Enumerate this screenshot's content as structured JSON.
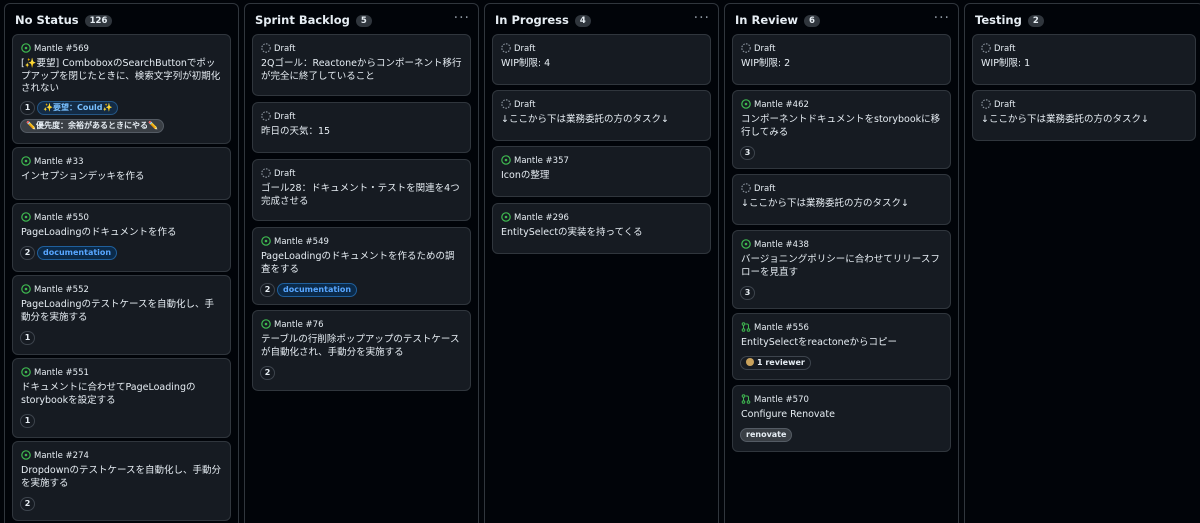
{
  "columns": [
    {
      "title": "No Status",
      "count": "126",
      "cards": [
        {
          "type": "issue",
          "meta": "Mantle #569",
          "title": "[✨要望] ComboboxのSearchButtonでポップアップを閉じたときに、検索文字列が初期化されない",
          "count": "1",
          "labels": [
            "✨要望：Could✨",
            "✏️優先度：余裕があるときにやる✏️"
          ]
        },
        {
          "type": "issue",
          "meta": "Mantle #33",
          "title": "インセプションデッキを作る"
        },
        {
          "type": "issue",
          "meta": "Mantle #550",
          "title": "PageLoadingのドキュメントを作る",
          "count": "2",
          "labels": [
            "documentation"
          ]
        },
        {
          "type": "issue",
          "meta": "Mantle #552",
          "title": "PageLoadingのテストケースを自動化し、手動分を実施する",
          "count": "1"
        },
        {
          "type": "issue",
          "meta": "Mantle #551",
          "title": "ドキュメントに合わせてPageLoadingのstorybookを設定する",
          "count": "1"
        },
        {
          "type": "issue",
          "meta": "Mantle #274",
          "title": "Dropdownのテストケースを自動化し、手動分を実施する",
          "count": "2"
        }
      ]
    },
    {
      "title": "Sprint Backlog",
      "count": "5",
      "cards": [
        {
          "type": "draft",
          "meta": "Draft",
          "title": "2Qゴール：Reactoneからコンポーネント移行が完全に終了していること"
        },
        {
          "type": "draft",
          "meta": "Draft",
          "title": "昨日の天気：15"
        },
        {
          "type": "draft",
          "meta": "Draft",
          "title": "ゴール28：ドキュメント・テストを関連を4つ完成させる"
        },
        {
          "type": "issue",
          "meta": "Mantle #549",
          "title": "PageLoadingのドキュメントを作るための調査をする",
          "count": "2",
          "labels": [
            "documentation"
          ]
        },
        {
          "type": "issue",
          "meta": "Mantle #76",
          "title": "テーブルの行削除ポップアップのテストケースが自動化され、手動分を実施する",
          "count": "2"
        }
      ]
    },
    {
      "title": "In Progress",
      "count": "4",
      "cards": [
        {
          "type": "draft",
          "meta": "Draft",
          "title": "WIP制限: 4"
        },
        {
          "type": "draft",
          "meta": "Draft",
          "title": "↓ここから下は業務委託の方のタスク↓"
        },
        {
          "type": "issue",
          "meta": "Mantle #357",
          "title": "Iconの整理"
        },
        {
          "type": "issue",
          "meta": "Mantle #296",
          "title": "EntitySelectの実装を持ってくる"
        }
      ]
    },
    {
      "title": "In Review",
      "count": "6",
      "cards": [
        {
          "type": "draft",
          "meta": "Draft",
          "title": "WIP制限: 2"
        },
        {
          "type": "issue",
          "meta": "Mantle #462",
          "title": "コンポーネントドキュメントをstorybookに移行してみる",
          "count": "3"
        },
        {
          "type": "draft",
          "meta": "Draft",
          "title": "↓ここから下は業務委託の方のタスク↓"
        },
        {
          "type": "issue",
          "meta": "Mantle #438",
          "title": "バージョニングポリシーに合わせてリリースフローを見直す",
          "count": "3"
        },
        {
          "type": "pr",
          "meta": "Mantle #556",
          "title": "EntitySelectをreactoneからコピー",
          "reviewer": "1 reviewer"
        },
        {
          "type": "pr",
          "meta": "Mantle #570",
          "title": "Configure Renovate",
          "labels": [
            "renovate"
          ]
        }
      ]
    },
    {
      "title": "Testing",
      "count": "2",
      "cards": [
        {
          "type": "draft",
          "meta": "Draft",
          "title": "WIP制限: 1"
        },
        {
          "type": "draft",
          "meta": "Draft",
          "title": "↓ここから下は業務委託の方のタスク↓"
        }
      ]
    }
  ],
  "menu_glyph": "···",
  "colors": {
    "background": "#010409",
    "card": "#161b22",
    "border": "#30363d",
    "open_issue": "#3fb950",
    "draft": "#8d96a0",
    "text": "#e6edf3"
  }
}
